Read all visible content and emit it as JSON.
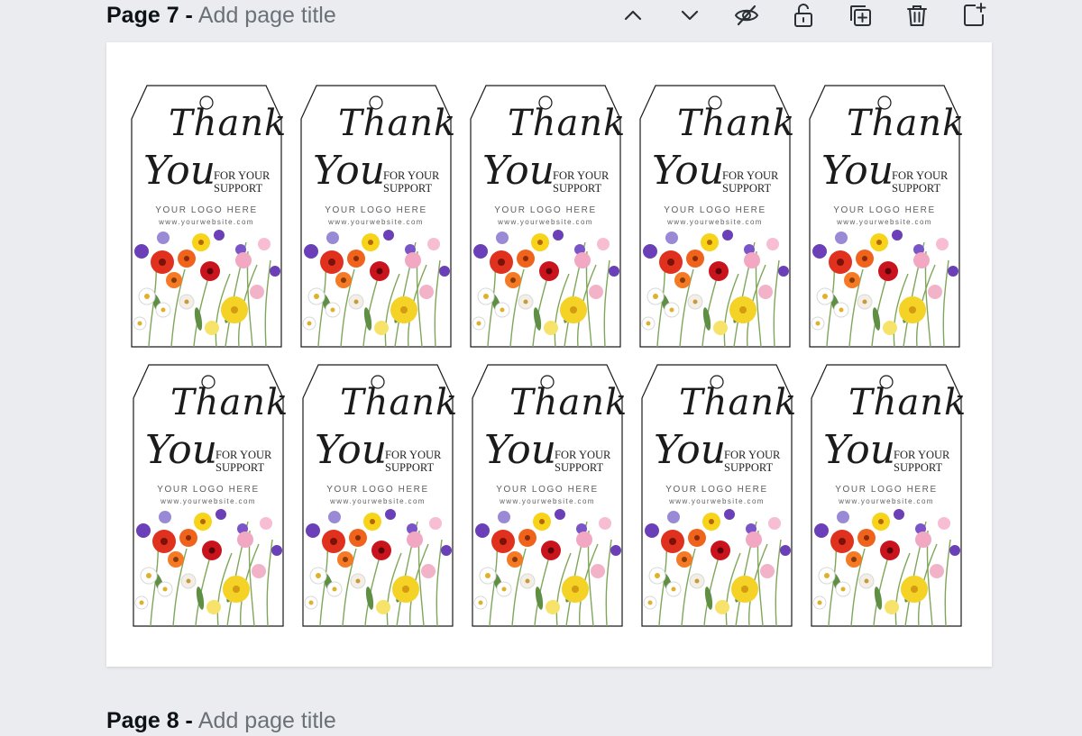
{
  "page": {
    "label": "Page 7 -",
    "title_placeholder": "Add page title"
  },
  "next_page": {
    "label": "Page 8 -",
    "title_placeholder": "Add page title"
  },
  "toolbar": {
    "icons": [
      "chevron-up-icon",
      "chevron-down-icon",
      "eye-slash-icon",
      "unlock-icon",
      "duplicate-icon",
      "trash-icon",
      "add-page-icon"
    ]
  },
  "tag": {
    "thank": "Thank",
    "you": "You",
    "support_line1": "FOR YOUR",
    "support_line2": "SUPPORT",
    "logo": "YOUR LOGO HERE",
    "website": "www.yourwebsite.com"
  },
  "grid": {
    "rows": 2,
    "columns": 5
  },
  "colors": {
    "app_background": "#ebecf0",
    "canvas": "#ffffff",
    "title_text": "#0d1216",
    "placeholder_text": "#6b7178",
    "flower_red": "#e0301e",
    "flower_orange": "#f0631c",
    "flower_yellow": "#f7d41a",
    "flower_purple": "#6a3fb8",
    "flower_pink": "#f2a7c3"
  }
}
